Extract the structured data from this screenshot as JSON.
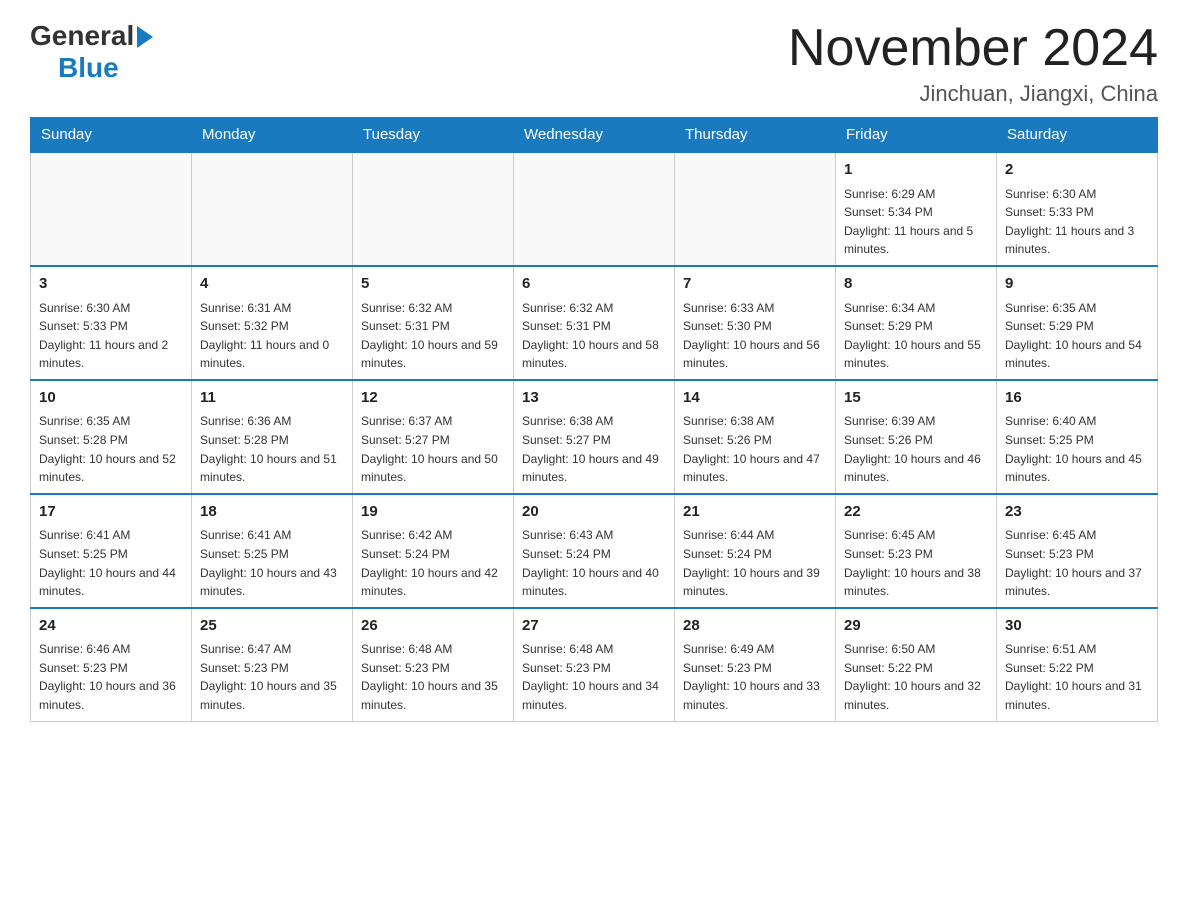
{
  "header": {
    "month_title": "November 2024",
    "location": "Jinchuan, Jiangxi, China",
    "logo_general": "General",
    "logo_blue": "Blue"
  },
  "weekdays": [
    "Sunday",
    "Monday",
    "Tuesday",
    "Wednesday",
    "Thursday",
    "Friday",
    "Saturday"
  ],
  "weeks": [
    [
      {
        "day": "",
        "info": ""
      },
      {
        "day": "",
        "info": ""
      },
      {
        "day": "",
        "info": ""
      },
      {
        "day": "",
        "info": ""
      },
      {
        "day": "",
        "info": ""
      },
      {
        "day": "1",
        "info": "Sunrise: 6:29 AM\nSunset: 5:34 PM\nDaylight: 11 hours and 5 minutes."
      },
      {
        "day": "2",
        "info": "Sunrise: 6:30 AM\nSunset: 5:33 PM\nDaylight: 11 hours and 3 minutes."
      }
    ],
    [
      {
        "day": "3",
        "info": "Sunrise: 6:30 AM\nSunset: 5:33 PM\nDaylight: 11 hours and 2 minutes."
      },
      {
        "day": "4",
        "info": "Sunrise: 6:31 AM\nSunset: 5:32 PM\nDaylight: 11 hours and 0 minutes."
      },
      {
        "day": "5",
        "info": "Sunrise: 6:32 AM\nSunset: 5:31 PM\nDaylight: 10 hours and 59 minutes."
      },
      {
        "day": "6",
        "info": "Sunrise: 6:32 AM\nSunset: 5:31 PM\nDaylight: 10 hours and 58 minutes."
      },
      {
        "day": "7",
        "info": "Sunrise: 6:33 AM\nSunset: 5:30 PM\nDaylight: 10 hours and 56 minutes."
      },
      {
        "day": "8",
        "info": "Sunrise: 6:34 AM\nSunset: 5:29 PM\nDaylight: 10 hours and 55 minutes."
      },
      {
        "day": "9",
        "info": "Sunrise: 6:35 AM\nSunset: 5:29 PM\nDaylight: 10 hours and 54 minutes."
      }
    ],
    [
      {
        "day": "10",
        "info": "Sunrise: 6:35 AM\nSunset: 5:28 PM\nDaylight: 10 hours and 52 minutes."
      },
      {
        "day": "11",
        "info": "Sunrise: 6:36 AM\nSunset: 5:28 PM\nDaylight: 10 hours and 51 minutes."
      },
      {
        "day": "12",
        "info": "Sunrise: 6:37 AM\nSunset: 5:27 PM\nDaylight: 10 hours and 50 minutes."
      },
      {
        "day": "13",
        "info": "Sunrise: 6:38 AM\nSunset: 5:27 PM\nDaylight: 10 hours and 49 minutes."
      },
      {
        "day": "14",
        "info": "Sunrise: 6:38 AM\nSunset: 5:26 PM\nDaylight: 10 hours and 47 minutes."
      },
      {
        "day": "15",
        "info": "Sunrise: 6:39 AM\nSunset: 5:26 PM\nDaylight: 10 hours and 46 minutes."
      },
      {
        "day": "16",
        "info": "Sunrise: 6:40 AM\nSunset: 5:25 PM\nDaylight: 10 hours and 45 minutes."
      }
    ],
    [
      {
        "day": "17",
        "info": "Sunrise: 6:41 AM\nSunset: 5:25 PM\nDaylight: 10 hours and 44 minutes."
      },
      {
        "day": "18",
        "info": "Sunrise: 6:41 AM\nSunset: 5:25 PM\nDaylight: 10 hours and 43 minutes."
      },
      {
        "day": "19",
        "info": "Sunrise: 6:42 AM\nSunset: 5:24 PM\nDaylight: 10 hours and 42 minutes."
      },
      {
        "day": "20",
        "info": "Sunrise: 6:43 AM\nSunset: 5:24 PM\nDaylight: 10 hours and 40 minutes."
      },
      {
        "day": "21",
        "info": "Sunrise: 6:44 AM\nSunset: 5:24 PM\nDaylight: 10 hours and 39 minutes."
      },
      {
        "day": "22",
        "info": "Sunrise: 6:45 AM\nSunset: 5:23 PM\nDaylight: 10 hours and 38 minutes."
      },
      {
        "day": "23",
        "info": "Sunrise: 6:45 AM\nSunset: 5:23 PM\nDaylight: 10 hours and 37 minutes."
      }
    ],
    [
      {
        "day": "24",
        "info": "Sunrise: 6:46 AM\nSunset: 5:23 PM\nDaylight: 10 hours and 36 minutes."
      },
      {
        "day": "25",
        "info": "Sunrise: 6:47 AM\nSunset: 5:23 PM\nDaylight: 10 hours and 35 minutes."
      },
      {
        "day": "26",
        "info": "Sunrise: 6:48 AM\nSunset: 5:23 PM\nDaylight: 10 hours and 35 minutes."
      },
      {
        "day": "27",
        "info": "Sunrise: 6:48 AM\nSunset: 5:23 PM\nDaylight: 10 hours and 34 minutes."
      },
      {
        "day": "28",
        "info": "Sunrise: 6:49 AM\nSunset: 5:23 PM\nDaylight: 10 hours and 33 minutes."
      },
      {
        "day": "29",
        "info": "Sunrise: 6:50 AM\nSunset: 5:22 PM\nDaylight: 10 hours and 32 minutes."
      },
      {
        "day": "30",
        "info": "Sunrise: 6:51 AM\nSunset: 5:22 PM\nDaylight: 10 hours and 31 minutes."
      }
    ]
  ]
}
